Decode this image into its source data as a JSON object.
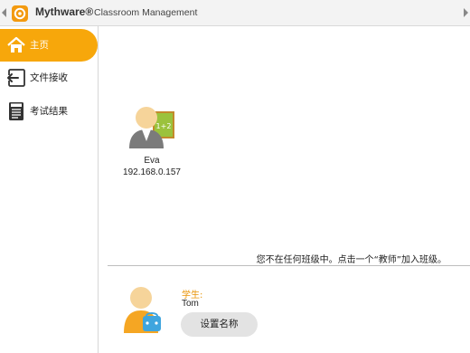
{
  "titlebar": {
    "brand": "Mythware®",
    "subtitle": "Classroom Management"
  },
  "sidebar": {
    "items": [
      {
        "label": "主页",
        "icon": "home-icon",
        "active": true
      },
      {
        "label": "文件接收",
        "icon": "file-receive-icon",
        "active": false
      },
      {
        "label": "考试结果",
        "icon": "exam-results-icon",
        "active": false
      }
    ]
  },
  "teacher": {
    "name": "Eva",
    "ip": "192.168.0.157",
    "icon": "teacher-avatar-icon"
  },
  "notice": "您不在任何班级中。点击一个“教师”加入班级。",
  "student": {
    "label": "学生:",
    "name": "Tom",
    "icon": "student-avatar-icon",
    "set_name_button": "设置名称"
  },
  "colors": {
    "accent": "#f7a70b",
    "student_label": "#e8950a"
  }
}
